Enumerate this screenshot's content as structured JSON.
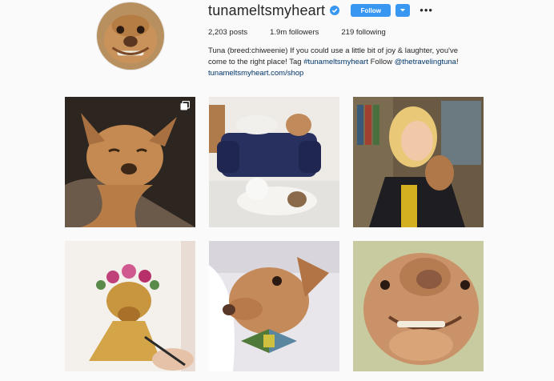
{
  "profile": {
    "username": "tunameltsmyheart",
    "follow_label": "Follow",
    "verified_icon": "verified-badge-icon",
    "more_icon": "more-options-icon",
    "accent_color": "#3897f0",
    "stats": {
      "posts": "2,203 posts",
      "followers": "1.9m followers",
      "following": "219 following"
    },
    "bio": {
      "line1": "Tuna (breed:chiweenie) If you could use a little bit of joy & laughter, you've come to the right place! Tag ",
      "hashtag": "#tunameltsmyheart",
      "follow_text": " Follow ",
      "mention": "@thetravelingtuna",
      "end": "!",
      "link": "tunameltsmyheart.com/shop"
    }
  },
  "posts": [
    {
      "name": "post-sleepy-tuna",
      "multi": true
    },
    {
      "name": "post-couch-dogs",
      "multi": false
    },
    {
      "name": "post-woman-kissing-tuna",
      "multi": false
    },
    {
      "name": "post-watercolor-painting",
      "multi": false
    },
    {
      "name": "post-tuna-bowtie",
      "multi": false
    },
    {
      "name": "post-tuna-closeup",
      "multi": false
    }
  ]
}
